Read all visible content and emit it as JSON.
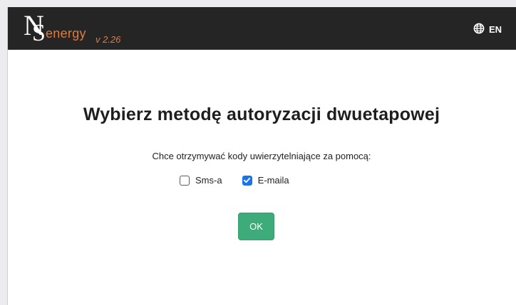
{
  "header": {
    "logo_letter_n": "N",
    "logo_letter_s": "S",
    "logo_word": "energy",
    "version": "v 2.26",
    "language": "EN"
  },
  "main": {
    "title": "Wybierz metodę autoryzacji dwuetapowej",
    "prompt": "Chce otrzymywać kody uwierzytelniające za pomocą:",
    "options": [
      {
        "label": "Sms-a",
        "checked": false
      },
      {
        "label": "E-maila",
        "checked": true
      }
    ],
    "ok_label": "OK"
  },
  "colors": {
    "topbar": "#252525",
    "brand_orange": "#e07b39",
    "checkbox_accent": "#1a73e8",
    "ok_button": "#3dab7a"
  },
  "icons": {
    "language": "globe-icon",
    "checked": "checkmark-icon"
  }
}
